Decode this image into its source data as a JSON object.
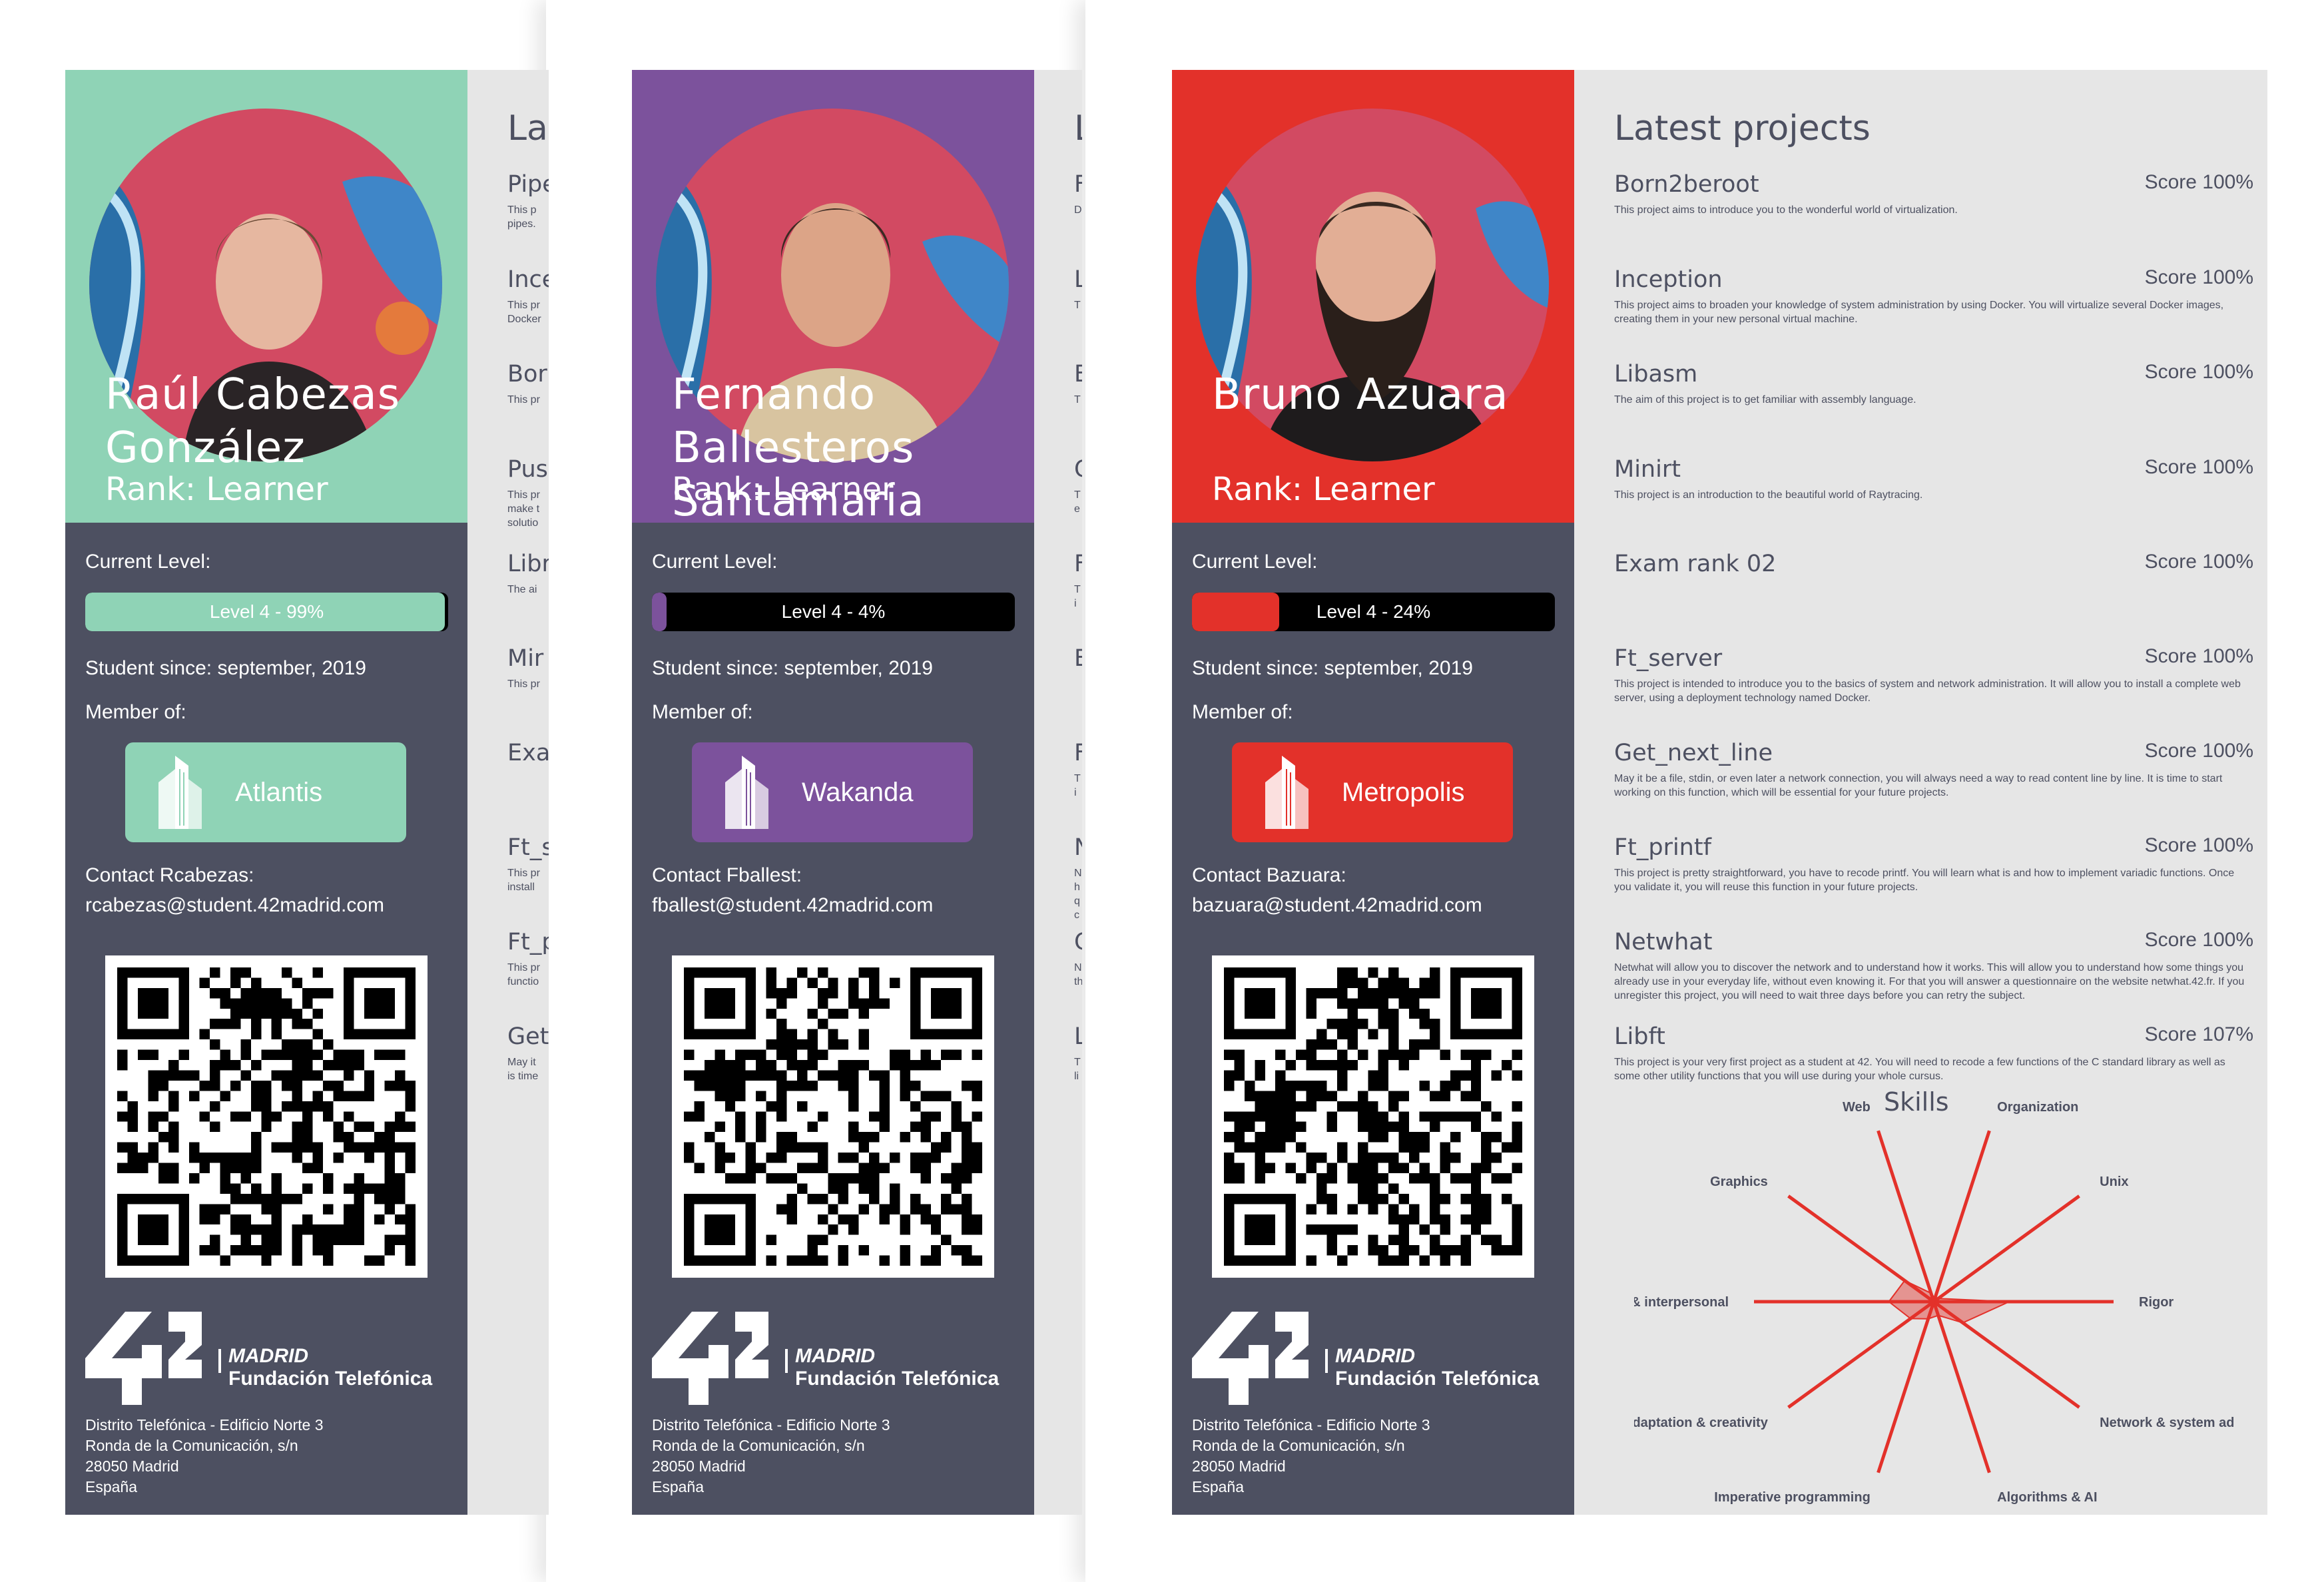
{
  "cards": [
    {
      "theme_color": "#8fd3b6",
      "name_lines": [
        "Raúl Cabezas",
        "González"
      ],
      "rank": "Rank: Learner",
      "current_level_label": "Current Level:",
      "level_text": "Level 4 - 99%",
      "level_progress": 0.99,
      "student_since": "Student since: september, 2019",
      "member_of_label": "Member of:",
      "coalition": "Atlantis",
      "contact_label": "Contact Rcabezas:",
      "email": "rcabezas@student.42madrid.com",
      "logo": {
        "line1": "MADRID",
        "line2": "Fundación Telefónica"
      },
      "address": [
        "Distrito Telefónica - Edificio Norte 3",
        "Ronda de la Comunicación, s/n",
        "28050 Madrid",
        "España"
      ],
      "latest_title": "La",
      "projects": [
        {
          "name": "Pipe",
          "score": "",
          "desc": "This p\npipes."
        },
        {
          "name": "Ince",
          "score": "",
          "desc": "This pr\nDocker"
        },
        {
          "name": "Bor",
          "score": "",
          "desc": "This pr"
        },
        {
          "name": "Pus",
          "score": "",
          "desc": "This pr\nmake t\nsolutio"
        },
        {
          "name": "Libr",
          "score": "",
          "desc": "The ai"
        },
        {
          "name": "Mir",
          "score": "",
          "desc": "This pr"
        },
        {
          "name": "Exa",
          "score": "",
          "desc": ""
        },
        {
          "name": "Ft_s",
          "score": "",
          "desc": "This pr\ninstall"
        },
        {
          "name": "Ft_p",
          "score": "",
          "desc": "This pr\nfunctio"
        },
        {
          "name": "Get",
          "score": "",
          "desc": "May it\nis time"
        }
      ]
    },
    {
      "theme_color": "#7c529c",
      "name_lines": [
        "Fernando",
        "Ballesteros",
        "Santamaria"
      ],
      "rank": "Rank: Learner",
      "current_level_label": "Current Level:",
      "level_text": "Level 4 - 4%",
      "level_progress": 0.04,
      "student_since": "Student since: september, 2019",
      "member_of_label": "Member of:",
      "coalition": "Wakanda",
      "contact_label": "Contact Fballest:",
      "email": "fballest@student.42madrid.com",
      "logo": {
        "line1": "MADRID",
        "line2": "Fundación Telefónica"
      },
      "address": [
        "Distrito Telefónica - Edificio Norte 3",
        "Ronda de la Comunicación, s/n",
        "28050 Madrid",
        "España"
      ],
      "latest_title": "L",
      "projects": [
        {
          "name": "F",
          "score": "",
          "desc": "D"
        },
        {
          "name": "L",
          "score": "",
          "desc": "T"
        },
        {
          "name": "E",
          "score": "",
          "desc": "T"
        },
        {
          "name": "C",
          "score": "",
          "desc": "T\ne"
        },
        {
          "name": "F",
          "score": "",
          "desc": "T\ni"
        },
        {
          "name": "E",
          "score": "",
          "desc": ""
        },
        {
          "name": "F",
          "score": "",
          "desc": "T\ni"
        },
        {
          "name": "N",
          "score": "",
          "desc": "N\nh\nq\nc"
        },
        {
          "name": "C",
          "score": "",
          "desc": "N\nth"
        },
        {
          "name": "L",
          "score": "",
          "desc": "T\nli"
        }
      ]
    },
    {
      "theme_color": "#e3312a",
      "name_lines": [
        "Bruno Azuara"
      ],
      "rank": "Rank: Learner",
      "current_level_label": "Current Level:",
      "level_text": "Level 4 - 24%",
      "level_progress": 0.24,
      "student_since": "Student since: september, 2019",
      "member_of_label": "Member of:",
      "coalition": "Metropolis",
      "contact_label": "Contact Bazuara:",
      "email": "bazuara@student.42madrid.com",
      "logo": {
        "line1": "MADRID",
        "line2": "Fundación Telefónica"
      },
      "address": [
        "Distrito Telefónica - Edificio Norte 3",
        "Ronda de la Comunicación, s/n",
        "28050 Madrid",
        "España"
      ],
      "latest_title": "Latest projects",
      "projects": [
        {
          "name": "Born2beroot",
          "score": "Score 100%",
          "desc": "This project aims to introduce you to the wonderful world of virtualization."
        },
        {
          "name": "Inception",
          "score": "Score 100%",
          "desc": "This project aims to broaden your knowledge of system administration by using Docker.  You will virtualize several Docker images, creating them in your new personal virtual machine."
        },
        {
          "name": "Libasm",
          "score": "Score 100%",
          "desc": "The aim of this project is to get familiar with assembly language."
        },
        {
          "name": "Minirt",
          "score": "Score 100%",
          "desc": "This project is an introduction to the beautiful world of Raytracing."
        },
        {
          "name": "Exam rank 02",
          "score": "Score 100%",
          "desc": ""
        },
        {
          "name": "Ft_server",
          "score": "Score 100%",
          "desc": "This project is intended to introduce you to the basics of system and network administration. It will allow you to install a complete web server, using a deployment technology named Docker."
        },
        {
          "name": "Get_next_line",
          "score": "Score 100%",
          "desc": "May it be a file, stdin, or even later a network connection, you will always need a way to read content line by line. It is time to start working on this function, which will be essential for your future projects."
        },
        {
          "name": "Ft_printf",
          "score": "Score 100%",
          "desc": "This project is pretty straightforward, you have to recode printf. You will learn what is and how to implement variadic functions. Once you validate it, you will reuse this function in your future projects."
        },
        {
          "name": "Netwhat",
          "score": "Score 100%",
          "desc": "Netwhat will allow you to discover the network and to understand how it works. This will allow you to understand how some things you already  use in your everyday life, without even knowing it. For that you will answer a questionnaire on the website netwhat.42.fr. If you unregister this project, you will need to wait three days before you can retry the subject."
        },
        {
          "name": "Libft",
          "score": "Score 107%",
          "desc": "This project is your very first project as a student at 42. You will need to recode a few functions of the C standard library as well as some other utility functions that you will use during your whole cursus."
        }
      ],
      "skills_title": "Skills",
      "skills": [
        {
          "label": "Organization",
          "value": 0.02
        },
        {
          "label": "Unix",
          "value": 0.03
        },
        {
          "label": "Rigor",
          "value": 0.42
        },
        {
          "label": "Network & system administration",
          "value": 0.2
        },
        {
          "label": "Algorithms & AI",
          "value": 0.08
        },
        {
          "label": "Imperative programming",
          "value": 0.1
        },
        {
          "label": "Adaptation & creativity",
          "value": 0.16
        },
        {
          "label": "Group & interpersonal",
          "value": 0.25
        },
        {
          "label": "Graphics",
          "value": 0.2
        },
        {
          "label": "Web",
          "value": 0.05
        }
      ]
    }
  ]
}
